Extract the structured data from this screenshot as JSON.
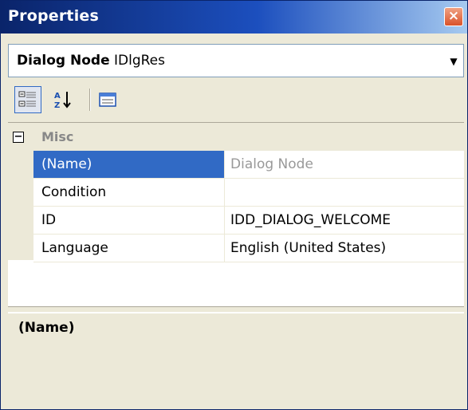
{
  "window": {
    "title": "Properties",
    "close_glyph": "×"
  },
  "node": {
    "type_label": "Dialog Node",
    "name": "IDlgRes",
    "dropdown_glyph": "▼"
  },
  "toolbar": {
    "buttons": [
      {
        "icon": "categorized-icon",
        "active": true
      },
      {
        "icon": "alphabetical-sort-icon",
        "active": false
      },
      {
        "icon": "property-pages-icon",
        "active": false
      }
    ]
  },
  "grid": {
    "category": {
      "expander_glyph": "⊟",
      "label": "Misc"
    },
    "rows": [
      {
        "name": "(Name)",
        "value": "Dialog Node",
        "selected": true,
        "readonly": true
      },
      {
        "name": "Condition",
        "value": "",
        "selected": false,
        "readonly": false
      },
      {
        "name": "ID",
        "value": "IDD_DIALOG_WELCOME",
        "selected": false,
        "readonly": false
      },
      {
        "name": "Language",
        "value": "English (United States)",
        "selected": false,
        "readonly": false
      }
    ]
  },
  "help": {
    "title": "(Name)",
    "description": ""
  },
  "colors": {
    "title_bar_start": "#0a246a",
    "title_bar_end": "#a6caf0",
    "selection": "#316ac5",
    "panel_bg": "#ece9d8",
    "readonly_text": "#999999"
  }
}
